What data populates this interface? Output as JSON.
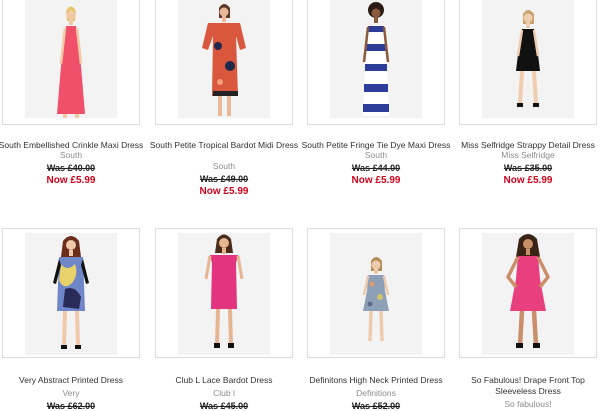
{
  "products": [
    {
      "name": "South Embellished Crinkle Maxi Dress",
      "brand": "South",
      "was": "Was £40.00",
      "now": "Now £5.99",
      "dress_color": "#f0506a",
      "dress_shape": "maxi"
    },
    {
      "name": "South Petite Tropical Bardot Midi Dress",
      "brand": "South",
      "was": "Was £49.00",
      "now": "Now £5.99",
      "dress_color": "#d9573c",
      "dress_shape": "bardot"
    },
    {
      "name": "South Petite Fringe Tie Dye Maxi Dress",
      "brand": "South",
      "was": "Was £44.00",
      "now": "Now £5.99",
      "dress_color": "#2d3d9a",
      "dress_shape": "tube"
    },
    {
      "name": "Miss Selfridge Strappy Detail Dress",
      "brand": "Miss Selfridge",
      "was": "Was £35.00",
      "now": "Now £5.99",
      "dress_color": "#111111",
      "dress_shape": "mini"
    },
    {
      "name": "Very Abstract Printed Dress",
      "brand": "Very",
      "was": "Was £62.00",
      "now": "",
      "dress_color": "#6f87c8",
      "dress_shape": "shift"
    },
    {
      "name": "Club L Lace Bardot Dress",
      "brand": "Club l",
      "was": "Was £45.00",
      "now": "",
      "dress_color": "#e3347f",
      "dress_shape": "bardot-short"
    },
    {
      "name": "Definitons High Neck Printed Dress",
      "brand": "Definitions",
      "was": "Was £52.00",
      "now": "",
      "dress_color": "#8ea0b8",
      "dress_shape": "skater"
    },
    {
      "name": "So Fabulous! Drape Front Top Sleeveless Dress",
      "brand": "So fabulous!",
      "was": "",
      "now": "",
      "dress_color": "#e8407e",
      "dress_shape": "drape"
    }
  ]
}
